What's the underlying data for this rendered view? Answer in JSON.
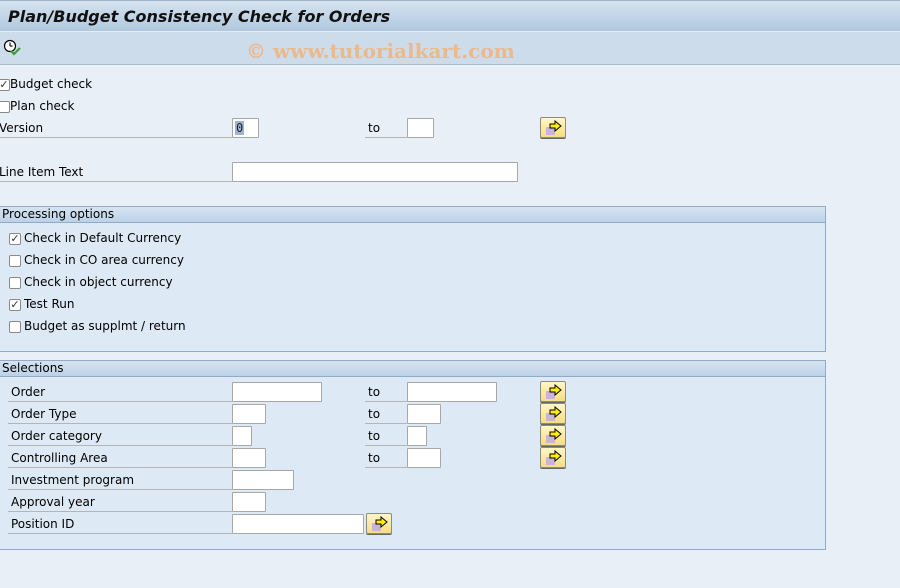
{
  "window": {
    "title": "Plan/Budget Consistency Check for Orders"
  },
  "toolbar": {
    "execute_icon": "execute-clock-check-icon",
    "watermark": "© www.tutorialkart.com"
  },
  "top": {
    "budget_check": {
      "label": "Budget check",
      "checked": true
    },
    "plan_check": {
      "label": "Plan check",
      "checked": false
    },
    "version": {
      "label": "Version",
      "from": "0",
      "to_label": "to",
      "to": ""
    },
    "line_item_text": {
      "label": "Line Item Text",
      "value": ""
    }
  },
  "processing": {
    "title": "Processing options",
    "options": [
      {
        "label": "Check in Default Currency",
        "checked": true
      },
      {
        "label": "Check in CO area currency",
        "checked": false
      },
      {
        "label": "Check in object currency",
        "checked": false
      },
      {
        "label": "Test Run",
        "checked": true
      },
      {
        "label": "Budget as supplmt / return",
        "checked": false
      }
    ]
  },
  "selections": {
    "title": "Selections",
    "to_label": "to",
    "rows": [
      {
        "label": "Order",
        "from": "",
        "to": ""
      },
      {
        "label": "Order Type",
        "from": "",
        "to": ""
      },
      {
        "label": "Order category",
        "from": "",
        "to": ""
      },
      {
        "label": "Controlling Area",
        "from": "",
        "to": ""
      },
      {
        "label": "Investment program",
        "value": ""
      },
      {
        "label": "Approval year",
        "value": ""
      },
      {
        "label": "Position ID",
        "value": ""
      }
    ]
  },
  "icons": {
    "multiple_selection": "multiple-selection-arrow-icon",
    "checkmark": "✓"
  }
}
